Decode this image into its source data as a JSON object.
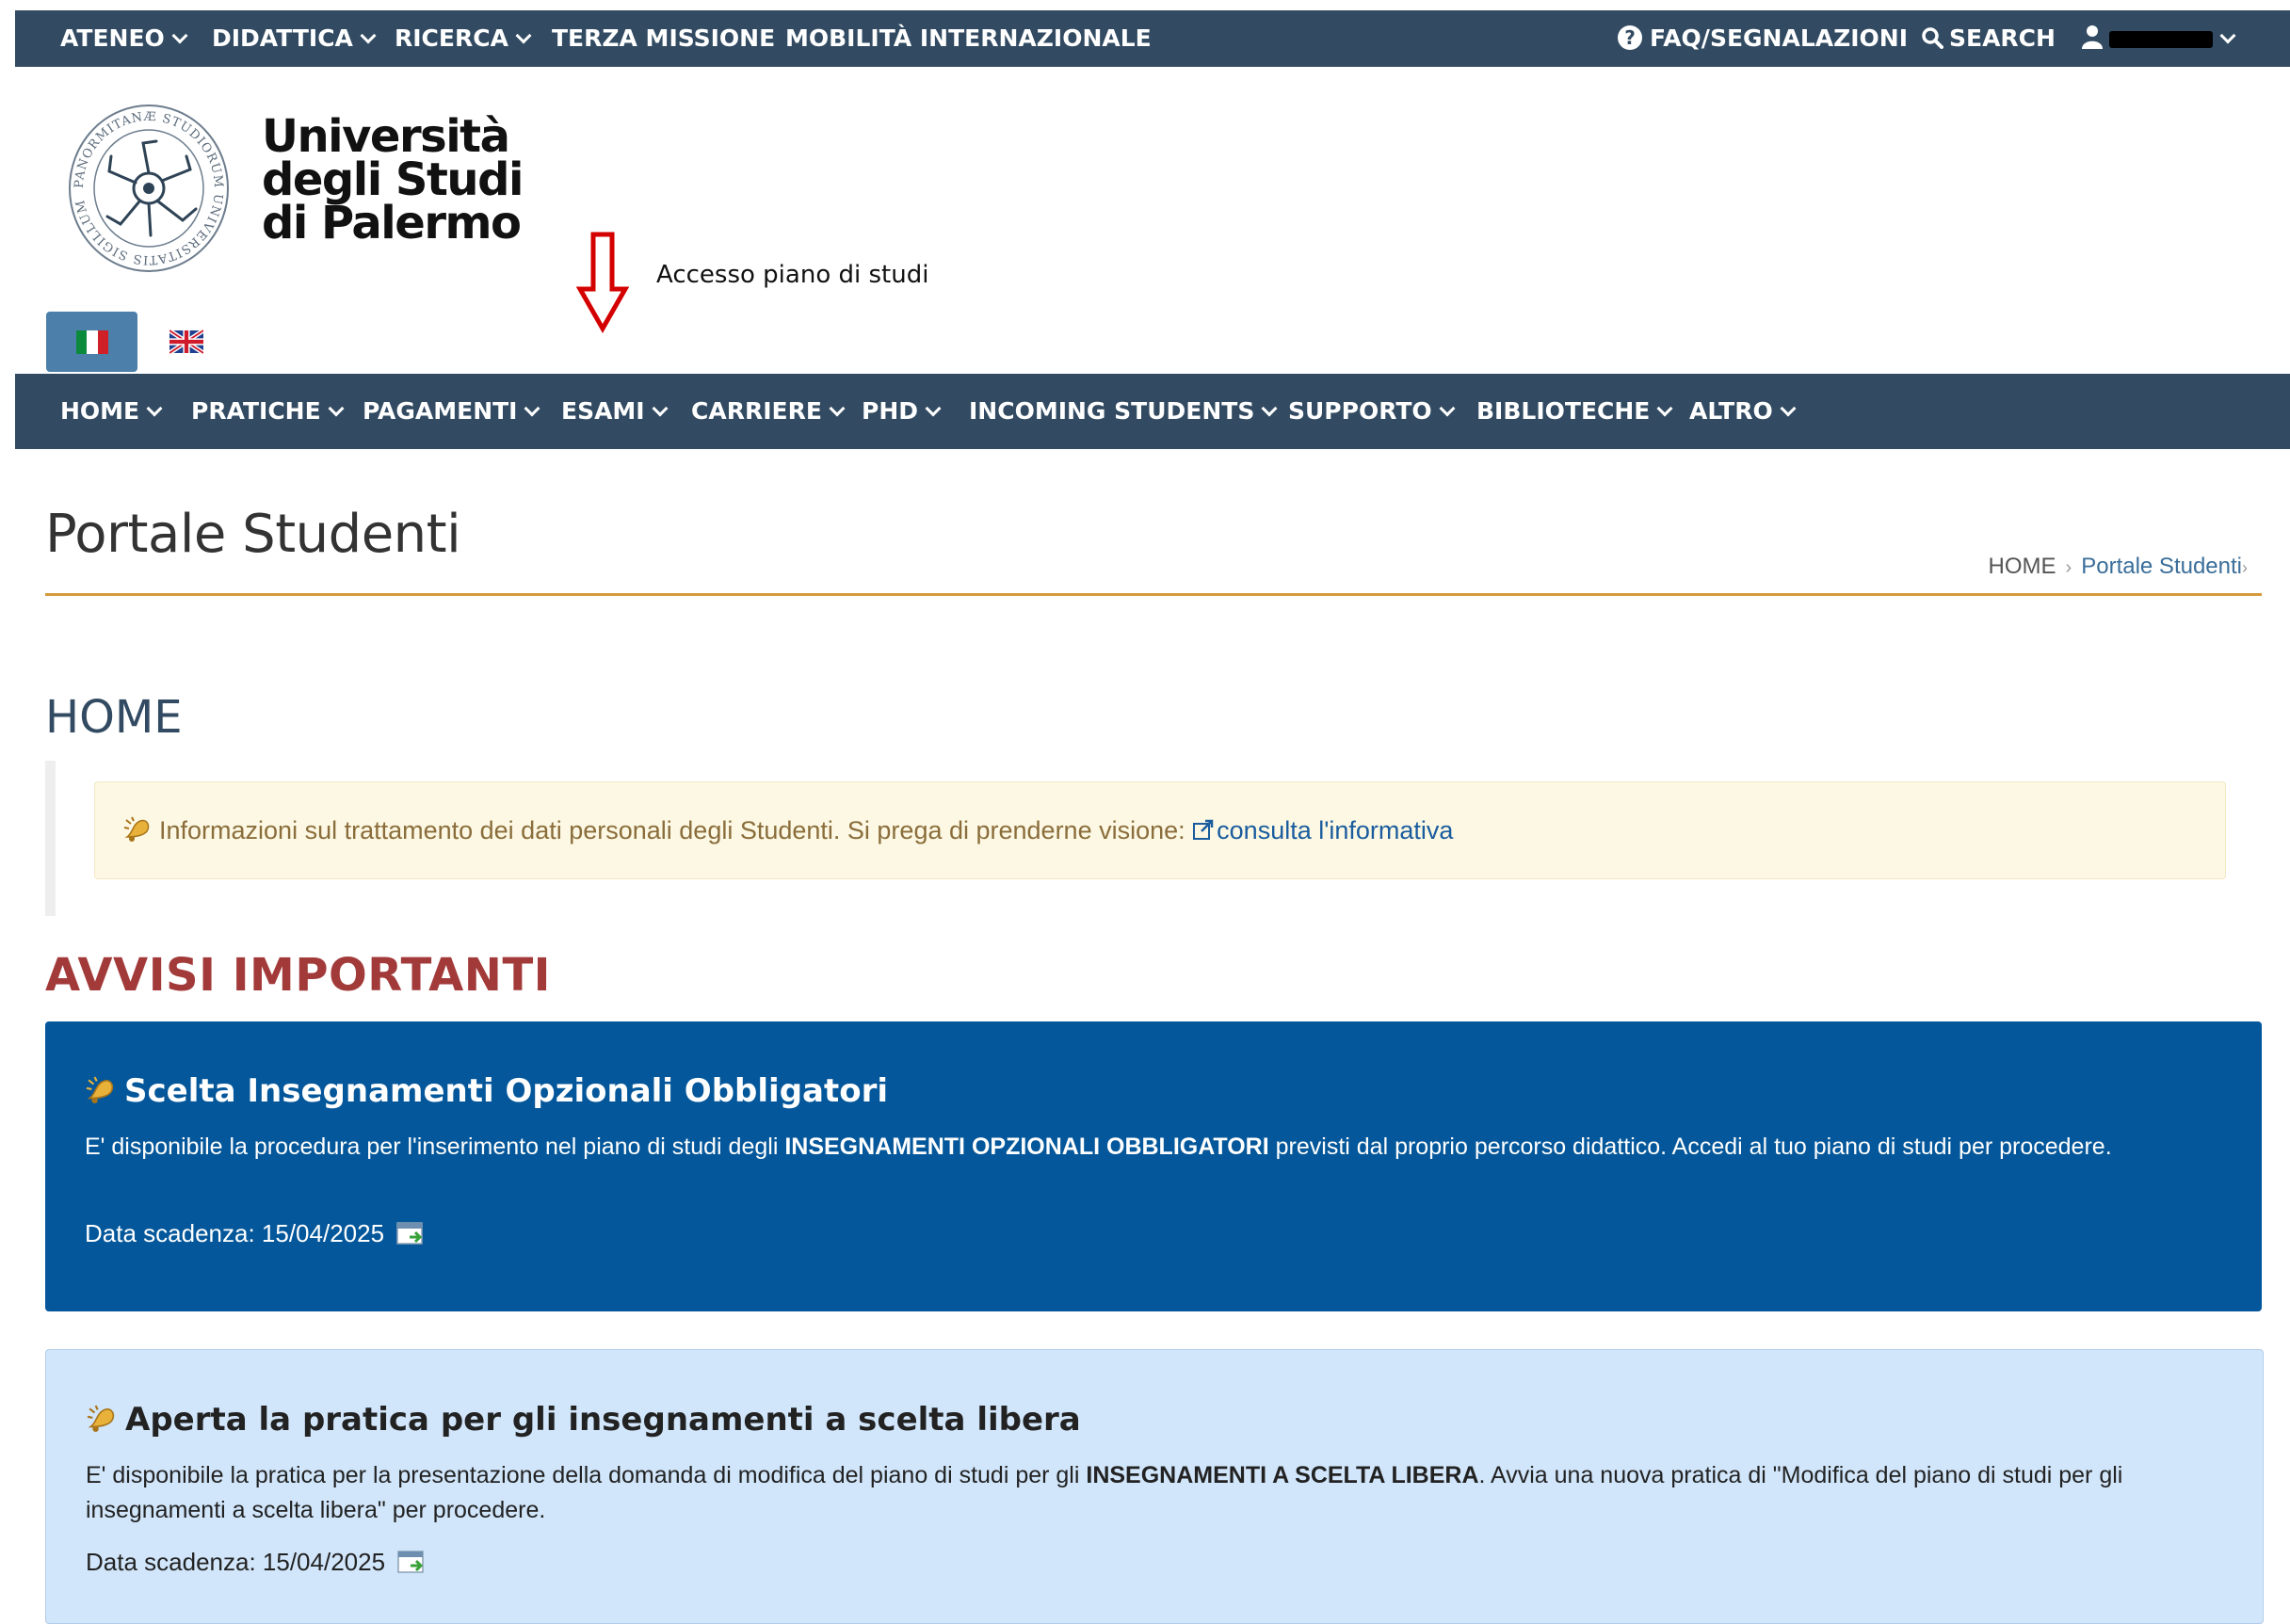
{
  "topbar": {
    "items": [
      {
        "label": "ATENEO"
      },
      {
        "label": "DIDATTICA"
      },
      {
        "label": "RICERCA"
      },
      {
        "label": "TERZA MISSIONE"
      },
      {
        "label": "MOBILITÀ INTERNAZIONALE"
      }
    ],
    "faq_label": "FAQ/SEGNALAZIONI",
    "search_label": "SEARCH"
  },
  "header": {
    "university_name": [
      "Università",
      "degli Studi",
      "di Palermo"
    ],
    "seal_text": "PANORMITANÆ STUDIORUM UNIVERSITATIS SIGILLUM",
    "annotation": "Accesso piano di studi",
    "annotation_color": "#d40000"
  },
  "nav": {
    "items": [
      {
        "label": "HOME"
      },
      {
        "label": "PRATICHE"
      },
      {
        "label": "PAGAMENTI"
      },
      {
        "label": "ESAMI"
      },
      {
        "label": "CARRIERE"
      },
      {
        "label": "PHD"
      },
      {
        "label": "INCOMING STUDENTS"
      },
      {
        "label": "SUPPORTO"
      },
      {
        "label": "BIBLIOTECHE"
      },
      {
        "label": "ALTRO"
      }
    ]
  },
  "page": {
    "title": "Portale Studenti",
    "breadcrumb": [
      "HOME",
      "Portale Studenti"
    ],
    "breadcrumb_trail": "›",
    "section_heading": "HOME",
    "info_text": "Informazioni sul trattamento dei dati personali degli Studenti. Si prega di prenderne visione:",
    "info_link": "consulta l'informativa",
    "avvisi_heading": "AVVISI IMPORTANTI"
  },
  "notices": [
    {
      "title": "Scelta Insegnamenti Opzionali Obbligatori",
      "body_before": "E' disponibile la procedura per l'inserimento nel piano di studi degli ",
      "body_bold": "INSEGNAMENTI OPZIONALI OBBLIGATORI",
      "body_after": " previsti dal proprio percorso didattico. Accedi al tuo piano di studi per procedere.",
      "date_label": "Data scadenza:",
      "date": "15/04/2025"
    },
    {
      "title": "Aperta la pratica per gli insegnamenti a scelta libera",
      "body_before": "E' disponibile la pratica per la presentazione della domanda di modifica del piano di studi per gli ",
      "body_bold": "INSEGNAMENTI A SCELTA LIBERA",
      "body_after": ".  Avvia una nuova pratica di \"Modifica del piano di studi per gli insegnamenti a scelta libera\" per procedere.",
      "date_label": "Data scadenza:",
      "date": "15/04/2025"
    }
  ],
  "icons": {
    "question": "question-circle-icon",
    "search": "search-icon",
    "user": "user-icon",
    "bell": "bell-icon",
    "external_link": "external-link-icon",
    "calendar": "calendar-add-icon",
    "flag_it": "italian-flag-icon",
    "flag_uk": "uk-flag-icon"
  },
  "colors": {
    "bar": "#324b62",
    "accent_rule": "#d59a3b",
    "avvisi": "#a33a3a",
    "notice_primary": "#04579a",
    "notice_secondary": "#d1e6fb",
    "info_bg": "#fcf8e3",
    "info_text": "#8a6d3b",
    "lang_active": "#4c7fa9"
  }
}
